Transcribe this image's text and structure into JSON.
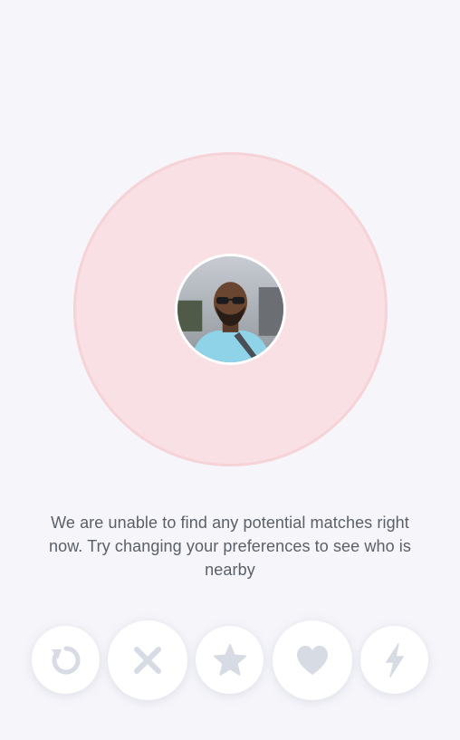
{
  "colors": {
    "background": "#f5f5fa",
    "radar_fill": "#f8e0e4",
    "radar_ring": "#f6d3d8",
    "button_icon": "#d7dce4",
    "message_text": "#5b6068"
  },
  "empty_state": {
    "message": "We are unable to find any potential matches right now. Try changing your preferences to see who is nearby"
  },
  "actions": [
    {
      "name": "rewind",
      "icon": "rewind-icon"
    },
    {
      "name": "nope",
      "icon": "close-icon"
    },
    {
      "name": "super-like",
      "icon": "star-icon"
    },
    {
      "name": "like",
      "icon": "heart-icon"
    },
    {
      "name": "boost",
      "icon": "lightning-icon"
    }
  ]
}
